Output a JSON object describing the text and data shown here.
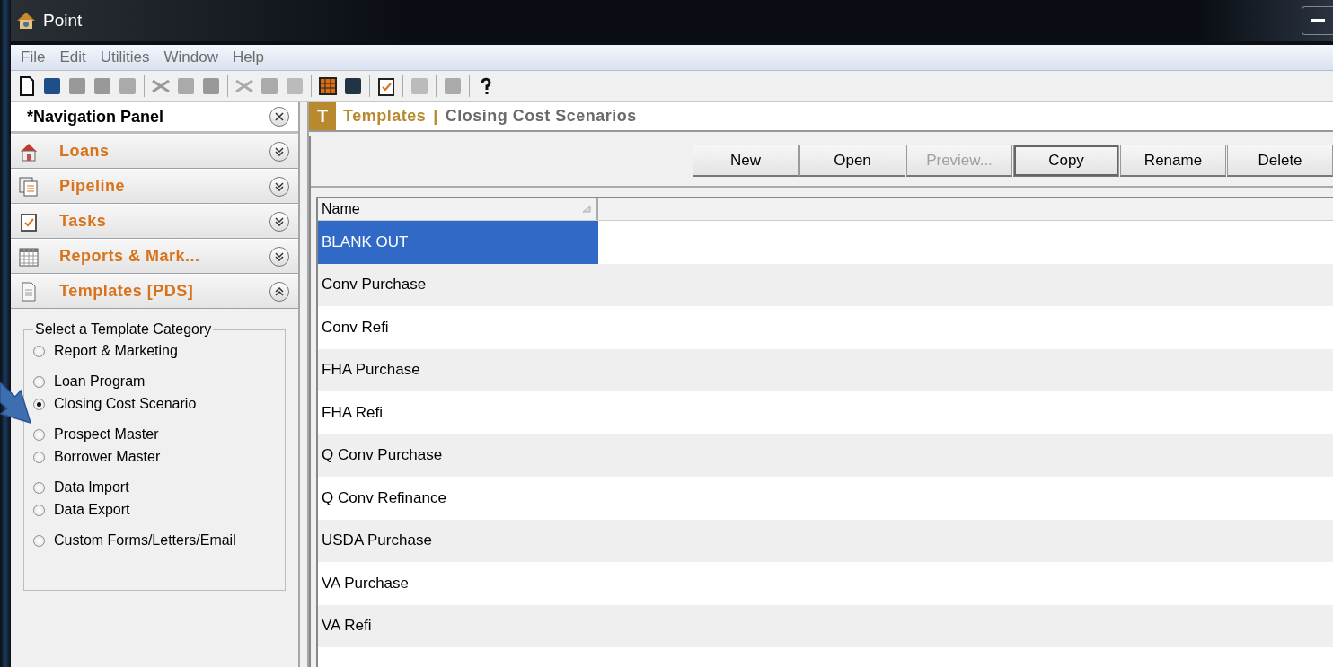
{
  "window": {
    "title": "Point"
  },
  "menu": [
    "File",
    "Edit",
    "Utilities",
    "Window",
    "Help"
  ],
  "navigation_panel": {
    "title": "*Navigation Panel",
    "sections": [
      {
        "label": "Loans",
        "expanded": false
      },
      {
        "label": "Pipeline",
        "expanded": false
      },
      {
        "label": "Tasks",
        "expanded": false
      },
      {
        "label": "Reports & Mark...",
        "expanded": false
      },
      {
        "label": "Templates [PDS]",
        "expanded": true
      }
    ],
    "category_box": {
      "title": "Select a Template Category",
      "groups": [
        {
          "options": [
            {
              "label": "Report & Marketing",
              "selected": false
            }
          ]
        },
        {
          "options": [
            {
              "label": "Loan Program",
              "selected": false
            },
            {
              "label": "Closing Cost Scenario",
              "selected": true
            }
          ]
        },
        {
          "options": [
            {
              "label": "Prospect Master",
              "selected": false
            },
            {
              "label": "Borrower Master",
              "selected": false
            }
          ]
        },
        {
          "options": [
            {
              "label": "Data Import",
              "selected": false
            },
            {
              "label": "Data Export",
              "selected": false
            }
          ]
        },
        {
          "options": [
            {
              "label": "Custom Forms/Letters/Email",
              "selected": false
            }
          ]
        }
      ]
    }
  },
  "content": {
    "badge": "T",
    "title_section": "Templates",
    "title_separator": "|",
    "title_page": "Closing Cost Scenarios",
    "buttons": [
      {
        "label": "New",
        "disabled": false,
        "focused": false
      },
      {
        "label": "Open",
        "disabled": false,
        "focused": false
      },
      {
        "label": "Preview...",
        "disabled": true,
        "focused": false
      },
      {
        "label": "Copy",
        "disabled": false,
        "focused": true
      },
      {
        "label": "Rename",
        "disabled": false,
        "focused": false
      },
      {
        "label": "Delete",
        "disabled": false,
        "focused": false
      }
    ],
    "table": {
      "columns": [
        "Name"
      ],
      "rows": [
        {
          "name": "BLANK OUT",
          "selected": true
        },
        {
          "name": "Conv Purchase",
          "selected": false
        },
        {
          "name": "Conv Refi",
          "selected": false
        },
        {
          "name": "FHA Purchase",
          "selected": false
        },
        {
          "name": "FHA Refi",
          "selected": false
        },
        {
          "name": "Q Conv Purchase",
          "selected": false
        },
        {
          "name": "Q Conv Refinance",
          "selected": false
        },
        {
          "name": "USDA Purchase",
          "selected": false
        },
        {
          "name": "VA Purchase",
          "selected": false
        },
        {
          "name": "VA Refi",
          "selected": false
        }
      ]
    }
  }
}
